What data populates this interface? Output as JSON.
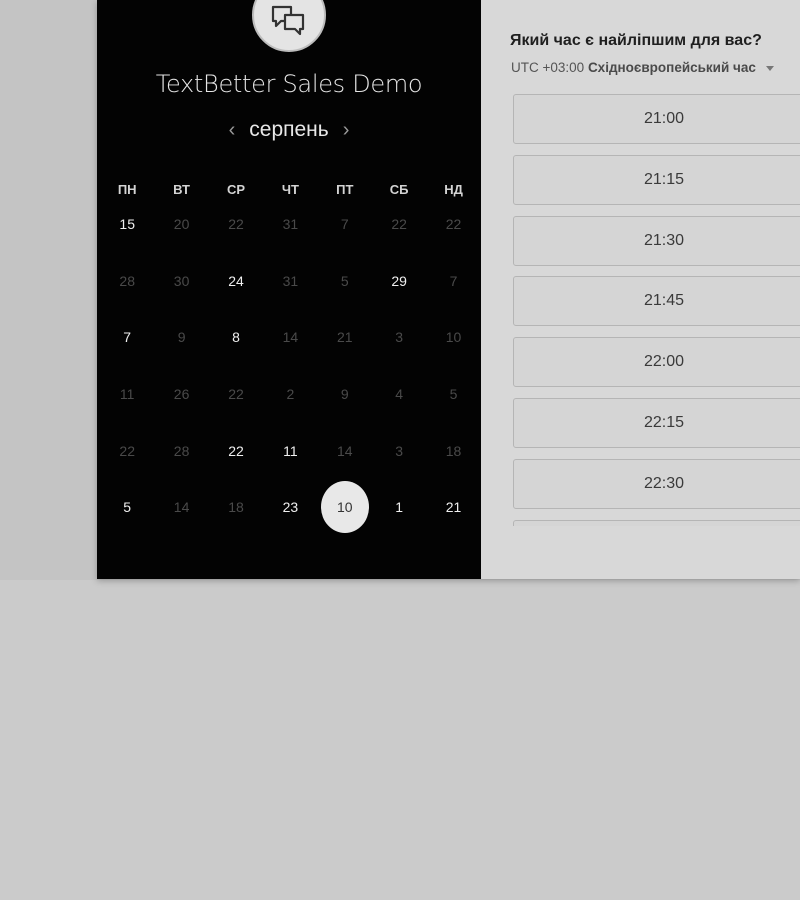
{
  "event": {
    "title": "TextBetter Sales Demo",
    "avatar_icon": "chat-bubbles-icon"
  },
  "calendar": {
    "month": "серпень",
    "prev_icon": "‹",
    "next_icon": "›",
    "weekdays": [
      "ПН",
      "ВТ",
      "СР",
      "ЧТ",
      "ПТ",
      "СБ",
      "НД"
    ],
    "weeks": [
      [
        {
          "d": "15",
          "a": true
        },
        {
          "d": "20",
          "a": false
        },
        {
          "d": "22",
          "a": false
        },
        {
          "d": "31",
          "a": false
        },
        {
          "d": "7",
          "a": false
        },
        {
          "d": "22",
          "a": false
        },
        {
          "d": "22",
          "a": false
        }
      ],
      [
        {
          "d": "28",
          "a": false
        },
        {
          "d": "30",
          "a": false
        },
        {
          "d": "24",
          "a": true
        },
        {
          "d": "31",
          "a": false
        },
        {
          "d": "5",
          "a": false
        },
        {
          "d": "29",
          "a": true
        },
        {
          "d": "7",
          "a": false
        }
      ],
      [
        {
          "d": "7",
          "a": true
        },
        {
          "d": "9",
          "a": false
        },
        {
          "d": "8",
          "a": true
        },
        {
          "d": "14",
          "a": false
        },
        {
          "d": "21",
          "a": false
        },
        {
          "d": "3",
          "a": false
        },
        {
          "d": "10",
          "a": false
        }
      ],
      [
        {
          "d": "11",
          "a": false
        },
        {
          "d": "26",
          "a": false
        },
        {
          "d": "22",
          "a": false
        },
        {
          "d": "2",
          "a": false
        },
        {
          "d": "9",
          "a": false
        },
        {
          "d": "4",
          "a": false
        },
        {
          "d": "5",
          "a": false
        }
      ],
      [
        {
          "d": "22",
          "a": false
        },
        {
          "d": "28",
          "a": false
        },
        {
          "d": "22",
          "a": true
        },
        {
          "d": "11",
          "a": true
        },
        {
          "d": "14",
          "a": false
        },
        {
          "d": "3",
          "a": false
        },
        {
          "d": "18",
          "a": false
        }
      ],
      [
        {
          "d": "5",
          "a": true
        },
        {
          "d": "14",
          "a": false
        },
        {
          "d": "18",
          "a": false
        },
        {
          "d": "23",
          "a": true
        },
        {
          "d": "10",
          "a": true,
          "selected": true
        },
        {
          "d": "1",
          "a": true
        },
        {
          "d": "21",
          "a": true
        }
      ]
    ]
  },
  "scheduler": {
    "question": "Який час є найліпшим для вас?",
    "tz_offset": "UTC +03:00",
    "tz_name": "Східноєвропейський час",
    "slots": [
      "21:00",
      "21:15",
      "21:30",
      "21:45",
      "22:00",
      "22:15",
      "22:30",
      ""
    ]
  },
  "colors": {
    "left_panel": "#030303",
    "right_panel": "#d8d8d8",
    "selected_day": "#e8e8e8"
  }
}
